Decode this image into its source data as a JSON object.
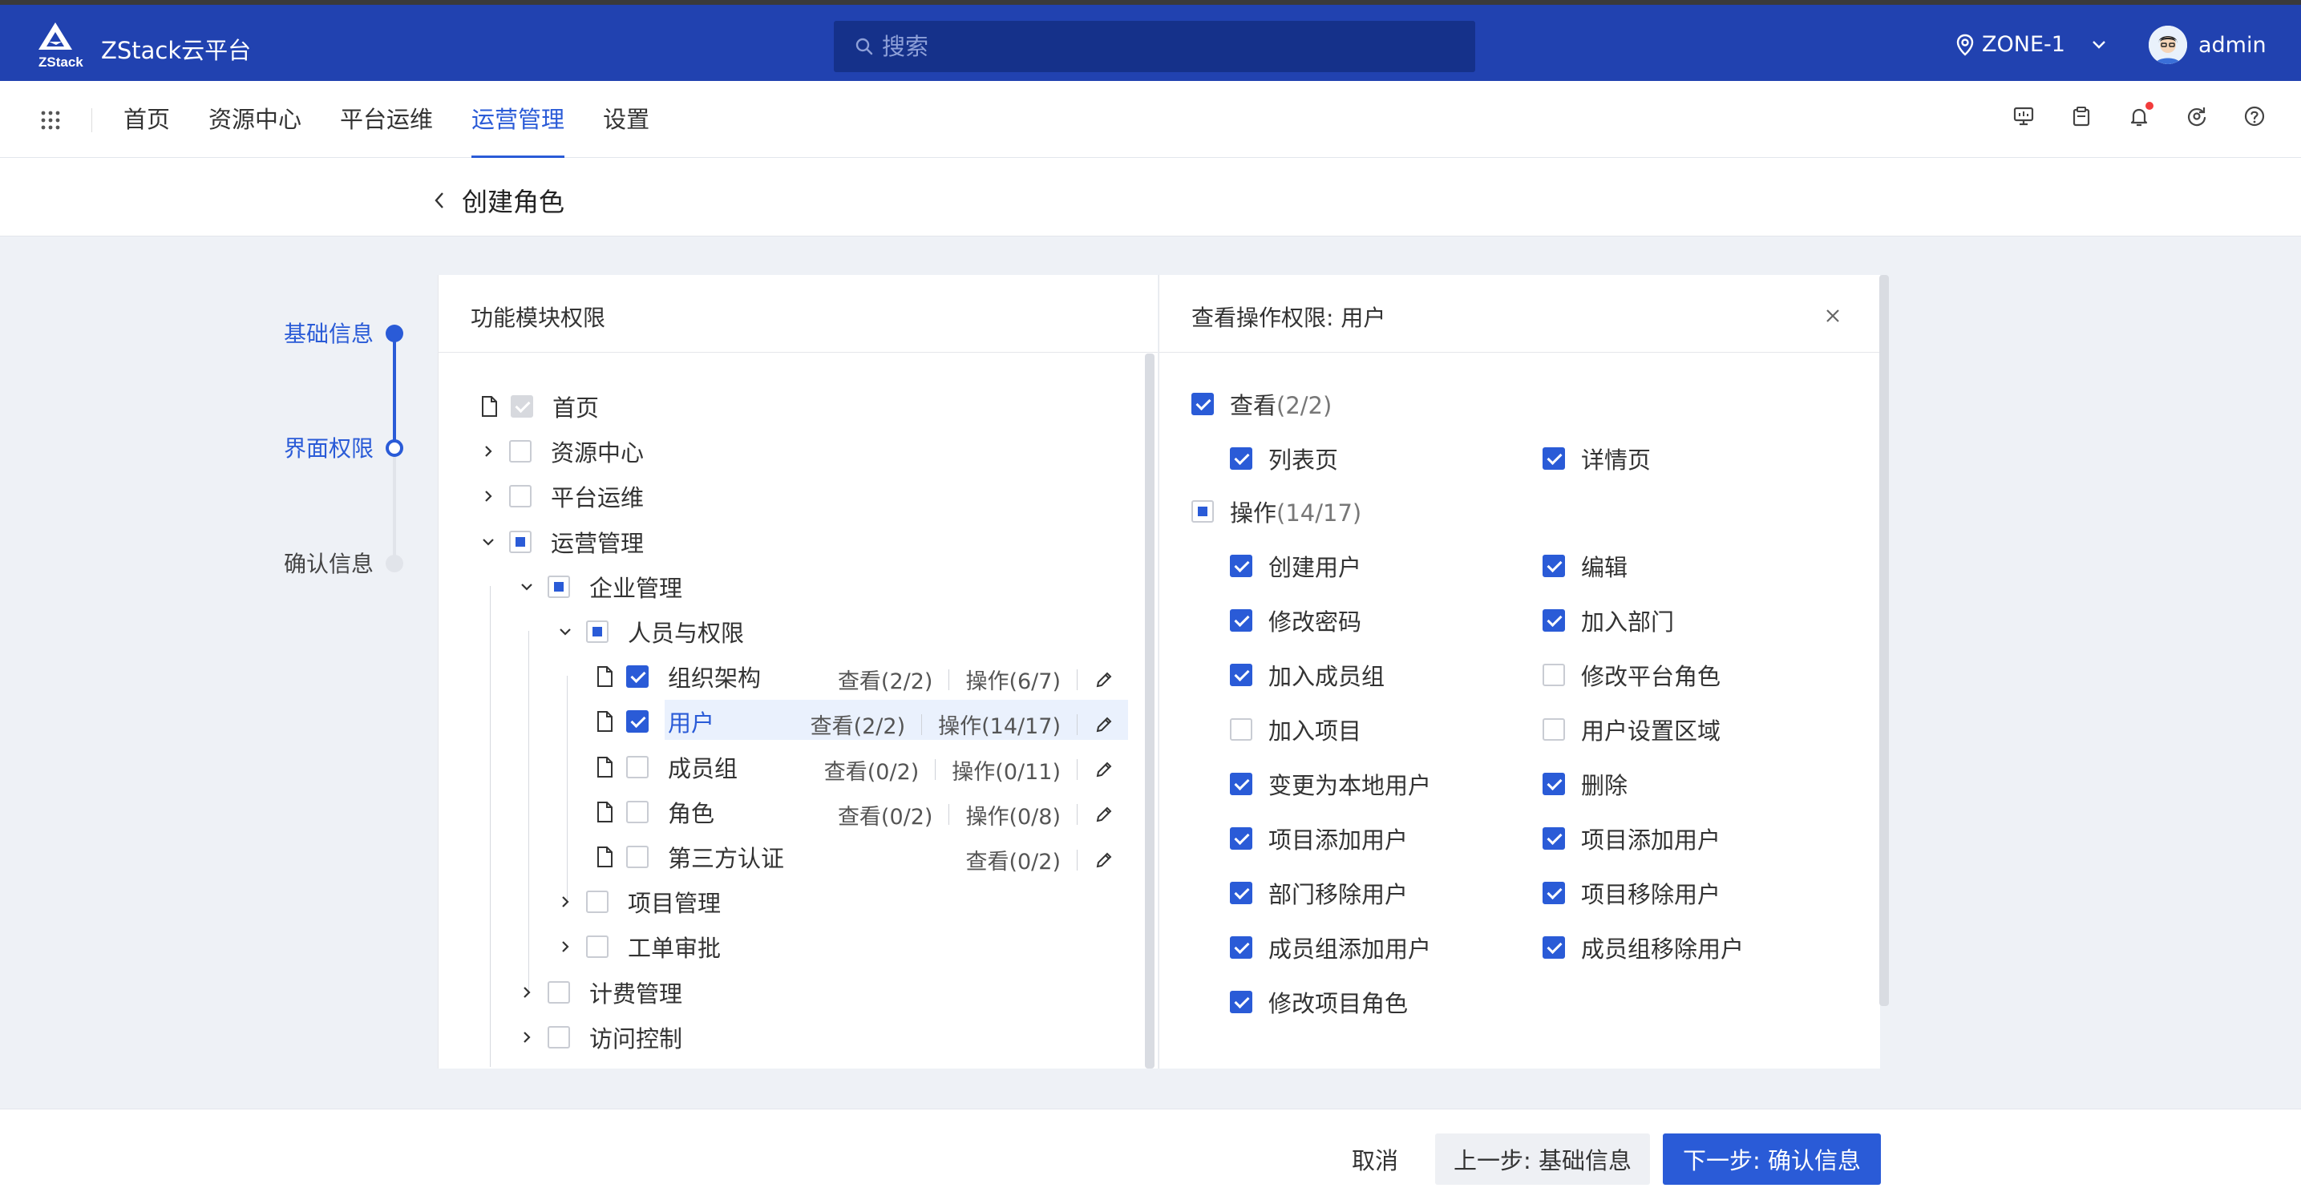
{
  "app": {
    "brand": "ZStack云平台",
    "logo_text": "ZStack"
  },
  "search": {
    "placeholder": "搜索"
  },
  "zone": {
    "label": "ZONE-1"
  },
  "user": {
    "name": "admin"
  },
  "nav": {
    "tabs": [
      "首页",
      "资源中心",
      "平台运维",
      "运营管理",
      "设置"
    ],
    "active_index": 3
  },
  "page": {
    "title": "创建角色"
  },
  "steps": [
    {
      "label": "基础信息",
      "state": "done"
    },
    {
      "label": "界面权限",
      "state": "current"
    },
    {
      "label": "确认信息",
      "state": "pending"
    }
  ],
  "left_panel": {
    "title": "功能模块权限",
    "tree": [
      {
        "label": "首页",
        "check": "disabled",
        "icon": "file"
      },
      {
        "label": "资源中心",
        "check": "none",
        "icon": "caret-right"
      },
      {
        "label": "平台运维",
        "check": "none",
        "icon": "caret-right"
      },
      {
        "label": "运营管理",
        "check": "partial",
        "icon": "caret-down"
      },
      {
        "label": "企业管理",
        "check": "partial",
        "icon": "caret-down"
      },
      {
        "label": "人员与权限",
        "check": "partial",
        "icon": "caret-down"
      },
      {
        "label": "组织架构",
        "check": "checked",
        "icon": "file",
        "view": "查看(2/2)",
        "op": "操作(6/7)"
      },
      {
        "label": "用户",
        "check": "checked",
        "icon": "file",
        "view": "查看(2/2)",
        "op": "操作(14/17)",
        "selected": true
      },
      {
        "label": "成员组",
        "check": "none",
        "icon": "file",
        "view": "查看(0/2)",
        "op": "操作(0/11)"
      },
      {
        "label": "角色",
        "check": "none",
        "icon": "file",
        "view": "查看(0/2)",
        "op": "操作(0/8)"
      },
      {
        "label": "第三方认证",
        "check": "none",
        "icon": "file",
        "view": "查看(0/2)",
        "op": ""
      },
      {
        "label": "项目管理",
        "check": "none",
        "icon": "caret-right"
      },
      {
        "label": "工单审批",
        "check": "none",
        "icon": "caret-right"
      },
      {
        "label": "计费管理",
        "check": "none",
        "icon": "caret-right"
      },
      {
        "label": "访问控制",
        "check": "none",
        "icon": "caret-right"
      }
    ]
  },
  "right_panel": {
    "title": "查看操作权限: 用户",
    "view_group": {
      "label": "查看",
      "count": "(2/2)",
      "check": "checked",
      "items": [
        {
          "label": "列表页",
          "checked": true
        },
        {
          "label": "详情页",
          "checked": true
        }
      ]
    },
    "op_group": {
      "label": "操作",
      "count": "(14/17)",
      "check": "partial",
      "items": [
        {
          "label": "创建用户",
          "checked": true
        },
        {
          "label": "编辑",
          "checked": true
        },
        {
          "label": "修改密码",
          "checked": true
        },
        {
          "label": "加入部门",
          "checked": true
        },
        {
          "label": "加入成员组",
          "checked": true
        },
        {
          "label": "修改平台角色",
          "checked": false
        },
        {
          "label": "加入项目",
          "checked": false
        },
        {
          "label": "用户设置区域",
          "checked": false
        },
        {
          "label": "变更为本地用户",
          "checked": true
        },
        {
          "label": "删除",
          "checked": true
        },
        {
          "label": "项目添加用户",
          "checked": true
        },
        {
          "label": "项目添加用户",
          "checked": true
        },
        {
          "label": "部门移除用户",
          "checked": true
        },
        {
          "label": "项目移除用户",
          "checked": true
        },
        {
          "label": "成员组添加用户",
          "checked": true
        },
        {
          "label": "成员组移除用户",
          "checked": true
        },
        {
          "label": "修改项目角色",
          "checked": true
        }
      ]
    }
  },
  "footer": {
    "cancel": "取消",
    "prev": "上一步: 基础信息",
    "next": "下一步: 确认信息"
  },
  "colors": {
    "primary": "#2a5bd7",
    "header_bg": "#2142b0",
    "search_bg": "#15318a",
    "notify_dot": "#f23c3c"
  }
}
